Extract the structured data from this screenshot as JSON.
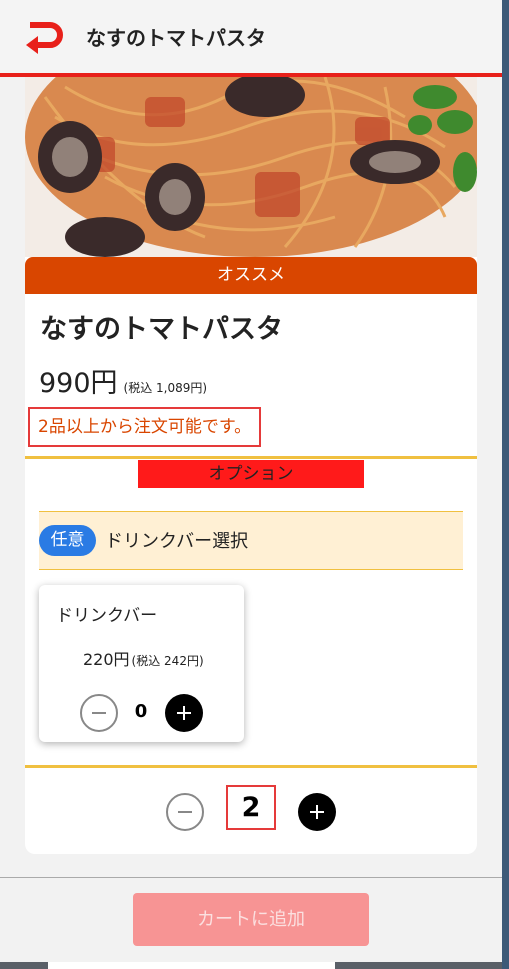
{
  "header": {
    "title": "なすのトマトパスタ",
    "back_icon": "back-arrow-icon",
    "accent": "#e8201a"
  },
  "product": {
    "badge": "オススメ",
    "name": "なすのトマトパスタ",
    "price": "990円",
    "price_tax": "(税込 1,089円)",
    "notice": "2品以上から注文可能です。"
  },
  "options": {
    "section_title": "オプション",
    "group_tag": "任意",
    "group_label": "ドリンクバー選択",
    "items": [
      {
        "name": "ドリンクバー",
        "price": "220円",
        "price_tax": "(税込 242円)",
        "qty": "0"
      }
    ]
  },
  "quantity": "2",
  "footer": {
    "add_to_cart": "カートに追加"
  },
  "colors": {
    "badge": "#d94600",
    "option_title": "#ff1a1a",
    "pill": "#2a7be4",
    "cart_button": "#f79494"
  }
}
